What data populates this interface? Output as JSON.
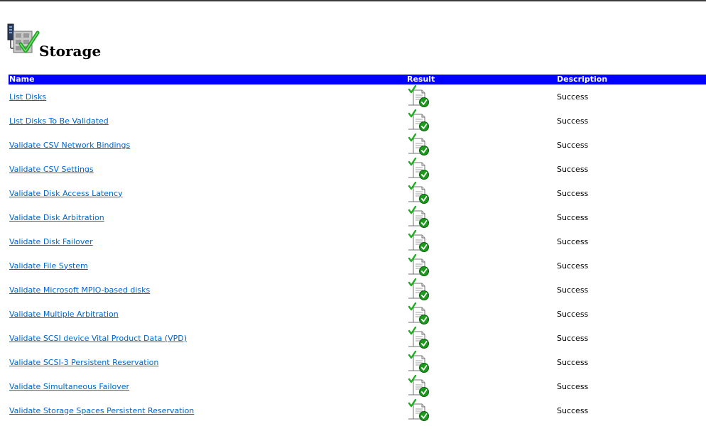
{
  "section": {
    "title": "Storage",
    "icon": "storage-validated-icon"
  },
  "table": {
    "headers": {
      "name": "Name",
      "result": "Result",
      "description": "Description"
    },
    "rows": [
      {
        "name": "List Disks",
        "result_icon": "success-check-icon",
        "description": "Success"
      },
      {
        "name": "List Disks To Be Validated",
        "result_icon": "success-check-icon",
        "description": "Success"
      },
      {
        "name": "Validate CSV Network Bindings",
        "result_icon": "success-check-icon",
        "description": "Success"
      },
      {
        "name": "Validate CSV Settings",
        "result_icon": "success-check-icon",
        "description": "Success"
      },
      {
        "name": "Validate Disk Access Latency",
        "result_icon": "success-check-icon",
        "description": "Success"
      },
      {
        "name": "Validate Disk Arbitration",
        "result_icon": "success-check-icon",
        "description": "Success"
      },
      {
        "name": "Validate Disk Failover",
        "result_icon": "success-check-icon",
        "description": "Success"
      },
      {
        "name": "Validate File System",
        "result_icon": "success-check-icon",
        "description": "Success"
      },
      {
        "name": "Validate Microsoft MPIO-based disks",
        "result_icon": "success-check-icon",
        "description": "Success"
      },
      {
        "name": "Validate Multiple Arbitration",
        "result_icon": "success-check-icon",
        "description": "Success"
      },
      {
        "name": "Validate SCSI device Vital Product Data (VPD)",
        "result_icon": "success-check-icon",
        "description": "Success"
      },
      {
        "name": "Validate SCSI-3 Persistent Reservation",
        "result_icon": "success-check-icon",
        "description": "Success"
      },
      {
        "name": "Validate Simultaneous Failover",
        "result_icon": "success-check-icon",
        "description": "Success"
      },
      {
        "name": "Validate Storage Spaces Persistent Reservation",
        "result_icon": "success-check-icon",
        "description": "Success"
      }
    ]
  },
  "colors": {
    "header_bg": "#0000ff",
    "header_text": "#ffffff",
    "link": "#0066cc",
    "check_green": "#22aa22"
  }
}
